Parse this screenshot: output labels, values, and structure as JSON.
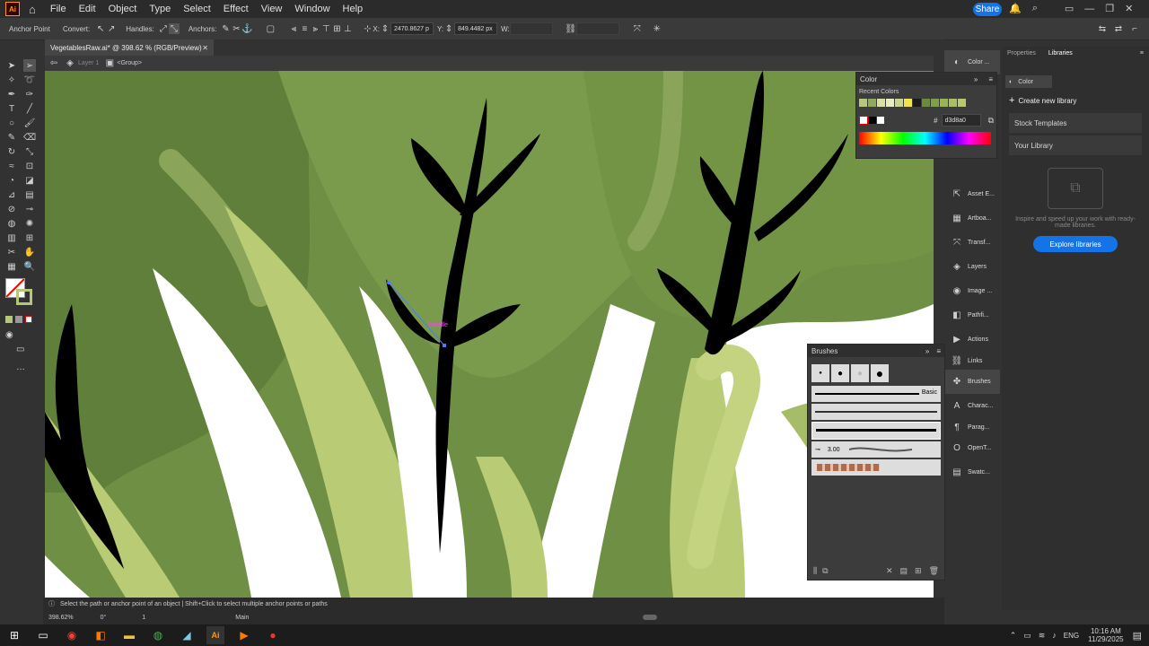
{
  "menubar": {
    "items": [
      "File",
      "Edit",
      "Object",
      "Type",
      "Select",
      "Effect",
      "View",
      "Window",
      "Help"
    ],
    "share_label": "Share"
  },
  "control_bar": {
    "tool_name": "Anchor Point",
    "convert_label": "Convert:",
    "handles_label": "Handles:",
    "anchors_label": "Anchors:",
    "x_label": "X:",
    "x_value": "2470.8627 p",
    "y_label": "Y:",
    "y_value": "849.4482 px",
    "w_label": "W:"
  },
  "document": {
    "tab_title": "VegetablesRaw.ai* @ 398.62 % (RGB/Preview)",
    "breadcrumb_layer": "Layer 1",
    "breadcrumb_group": "<Group>"
  },
  "canvas": {
    "handle_label": "handle"
  },
  "color_panel": {
    "title": "Color",
    "recent_colors_label": "Recent Colors",
    "hex_value": "d3d8a0",
    "swatches": [
      "#b5c77a",
      "#8fa85a",
      "#d8dfa0",
      "#e8ecc0",
      "#c9d48c",
      "#f2e34a",
      "#1a1a1a",
      "#6b8a3d",
      "#7fa046",
      "#98b552",
      "#a9bf62",
      "#b7c96c"
    ]
  },
  "dock": {
    "items": [
      "Color ...",
      "Asset E...",
      "Artboa...",
      "Transf...",
      "Layers",
      "Image ...",
      "Pathfi...",
      "Actions",
      "Links",
      "Brushes",
      "Charac...",
      "Parag...",
      "OpenT...",
      "Swatc..."
    ]
  },
  "brushes_panel": {
    "title": "Brushes",
    "basic_label": "Basic",
    "size_value": "3.00"
  },
  "libraries": {
    "tab_properties": "Properties",
    "tab_libraries": "Libraries",
    "color_chip": "Color",
    "create_new": "Create new library",
    "stock_templates": "Stock Templates",
    "your_library": "Your Library",
    "inspire_text": "Inspire and speed up your work with ready-made libraries.",
    "explore_button": "Explore libraries"
  },
  "status": {
    "hint": "Select the path or anchor point of an object  |  Shift+Click to select multiple anchor points or paths",
    "zoom": "398.62%",
    "rotation": "0°",
    "artboard": "1",
    "mode": "Main"
  },
  "taskbar": {
    "language": "ENG",
    "time": "10:16 AM",
    "date": "11/29/2025"
  }
}
